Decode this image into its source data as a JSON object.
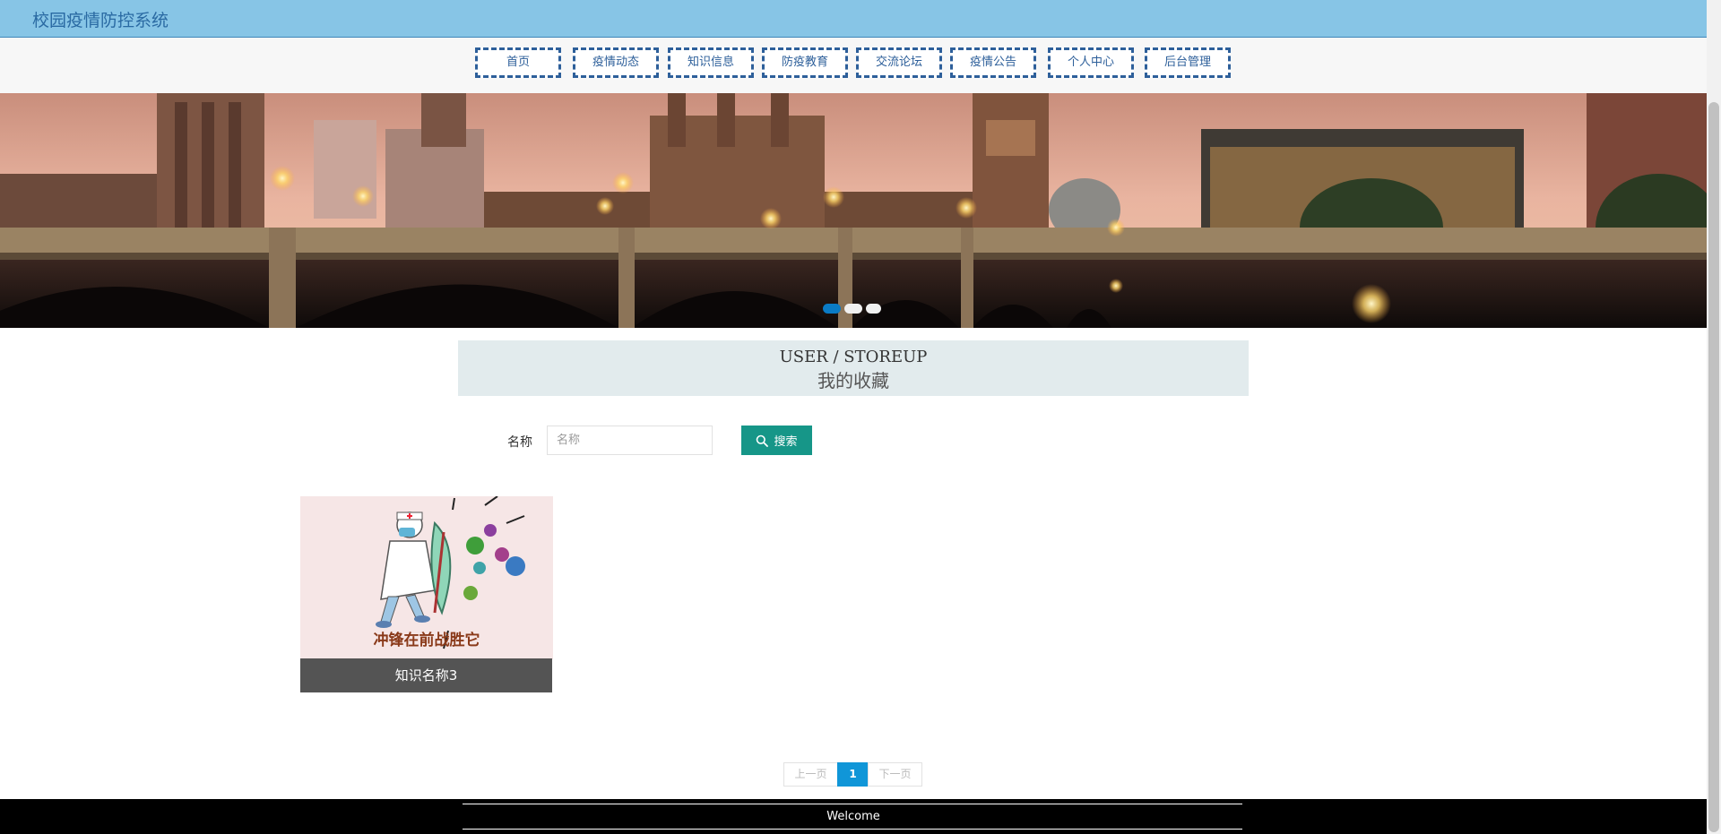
{
  "header": {
    "title": "校园疫情防控系统"
  },
  "nav": {
    "items": [
      {
        "label": "首页"
      },
      {
        "label": "疫情动态"
      },
      {
        "label": "知识信息"
      },
      {
        "label": "防疫教育"
      },
      {
        "label": "交流论坛"
      },
      {
        "label": "疫情公告"
      },
      {
        "label": "个人中心"
      },
      {
        "label": "后台管理"
      }
    ]
  },
  "banner": {
    "slide_count": 3,
    "active_index": 0
  },
  "section": {
    "title_en": "USER / STOREUP",
    "title_cn": "我的收藏"
  },
  "search": {
    "label": "名称",
    "placeholder": "名称",
    "value": "",
    "button_label": "搜索"
  },
  "cards": [
    {
      "title": "知识名称3",
      "image_text": "冲锋在前战胜它"
    }
  ],
  "pagination": {
    "prev_label": "上一页",
    "current_page": "1",
    "next_label": "下一页"
  },
  "footer": {
    "text": "Welcome"
  },
  "colors": {
    "header_bg": "#87c5e6",
    "nav_border": "#2d5f9a",
    "search_button": "#169688",
    "pager_active": "#1096d8",
    "card_caption_bg": "#545454"
  }
}
